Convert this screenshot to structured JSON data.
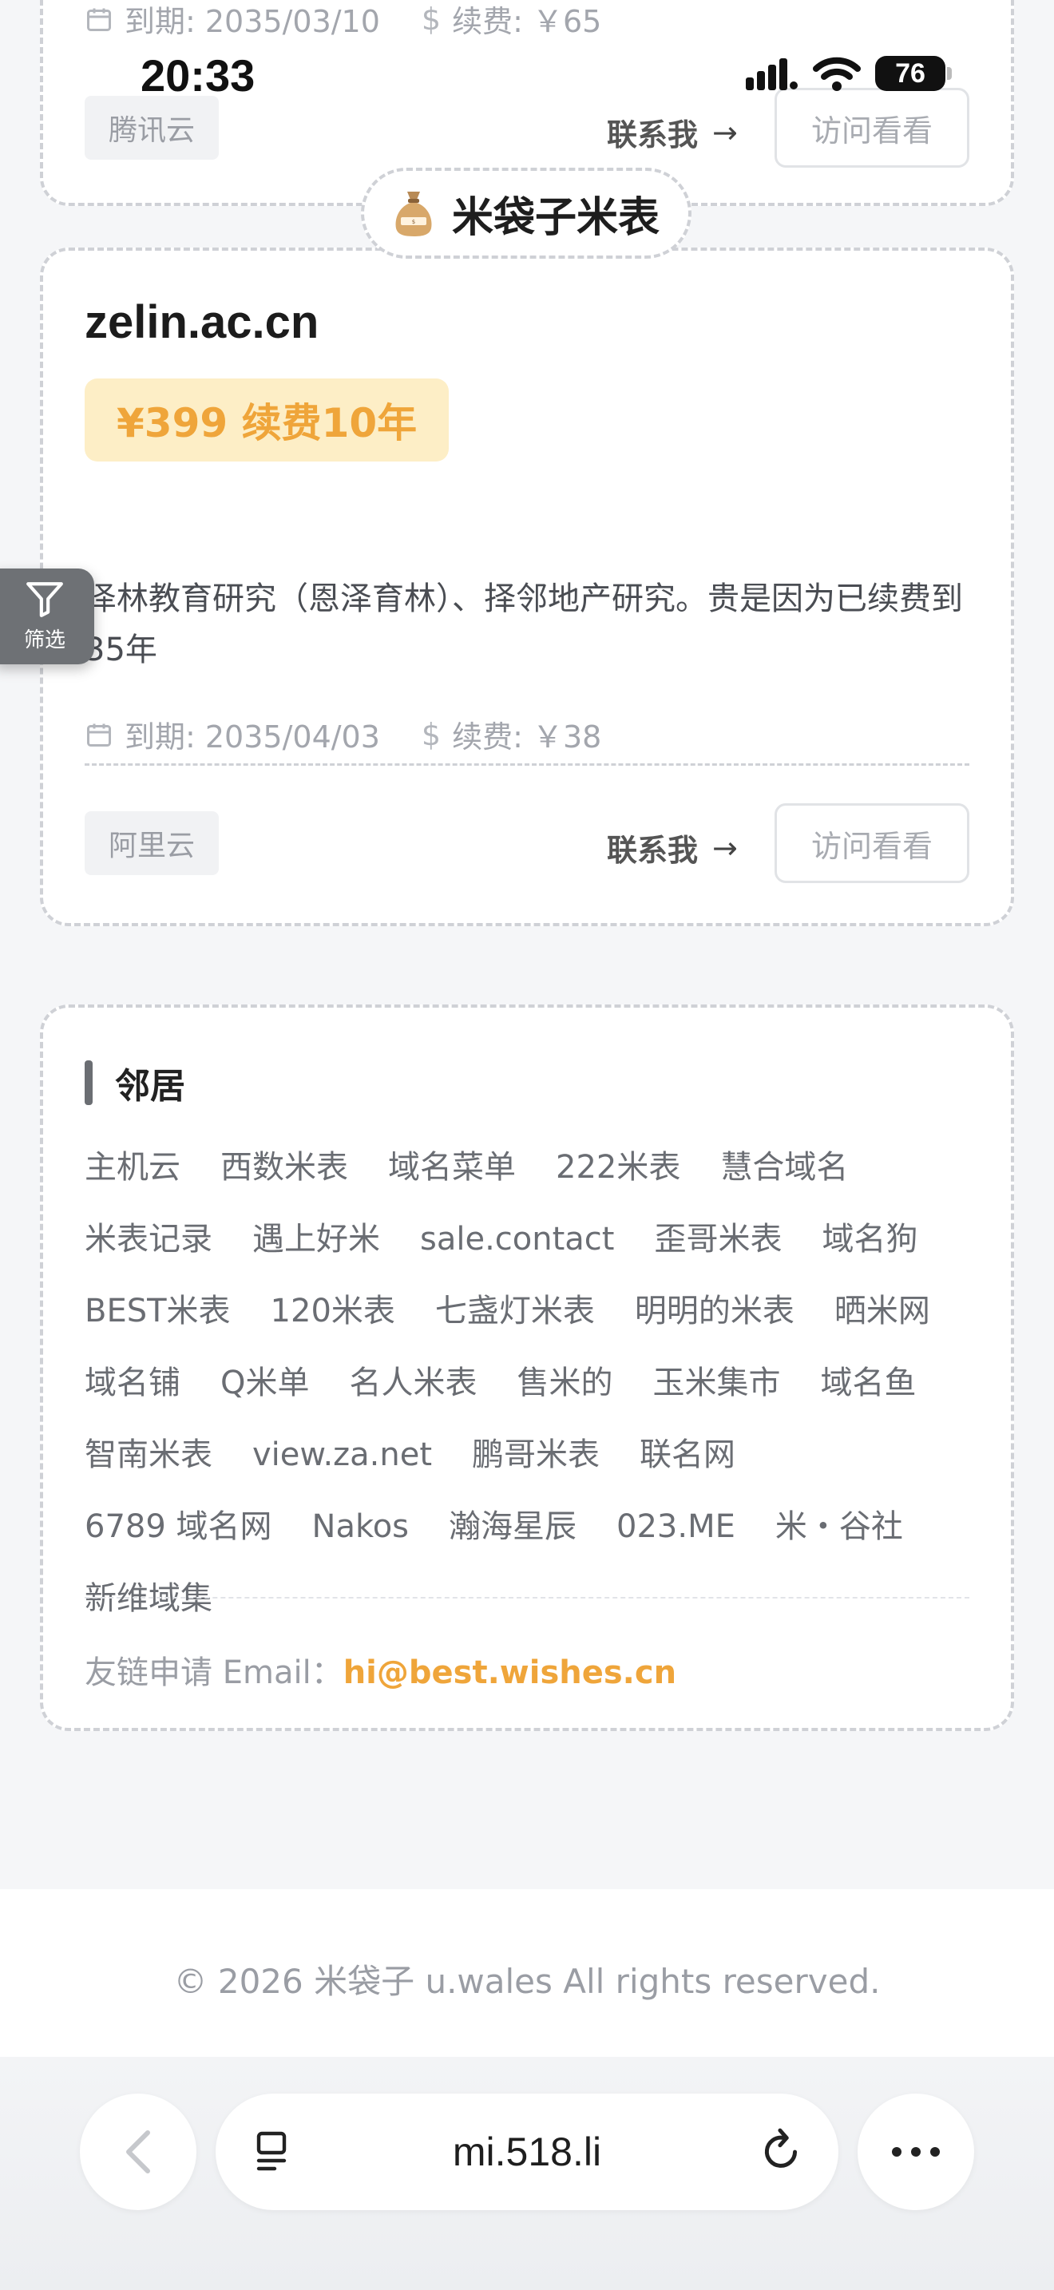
{
  "status_bar": {
    "time": "20:33",
    "battery": "76",
    "icons": [
      "signal-icon",
      "wifi-icon",
      "battery-icon"
    ]
  },
  "previous_card": {
    "expiry": "到期: 2035/03/10",
    "renewal": "续费: ￥65",
    "provider": "腾讯云",
    "contact_label": "联系我",
    "visit_label": "访问看看"
  },
  "section": {
    "title": "米袋子米表",
    "icon": "money-bag-icon"
  },
  "listing": {
    "domain": "zelin.ac.cn",
    "price": "¥399 续费10年",
    "description": "泽林教育研究（恩泽育林）、择邻地产研究。贵是因为已续费到35年",
    "expiry": "到期: 2035/04/03",
    "renewal": "续费: ￥38",
    "provider": "阿里云",
    "contact_label": "联系我",
    "visit_label": "访问看看"
  },
  "filter": {
    "label": "筛选",
    "icon": "filter-icon"
  },
  "neighbors": {
    "title": "邻居",
    "links": [
      "主机云",
      "西数米表",
      "域名菜单",
      "222米表",
      "慧合域名",
      "米表记录",
      "遇上好米",
      "sale.contact",
      "歪哥米表",
      "域名狗",
      "BEST米表",
      "120米表",
      "七盏灯米表",
      "明明的米表",
      "晒米网",
      "域名铺",
      "Q米单",
      "名人米表",
      "售米的",
      "玉米集市",
      "域名鱼",
      "智南米表",
      "view.za.net",
      "鹏哥米表",
      "联名网",
      "6789 域名网",
      "Nakos",
      "瀚海星辰",
      "023.ME",
      "米・谷社",
      "新维域集"
    ],
    "apply_label": "友链申请 Email：",
    "apply_email": "hi@best.wishes.cn"
  },
  "footer": {
    "copyright": "© 2026 米袋子 u.wales All rights reserved."
  },
  "browser": {
    "url": "mi.518.li"
  },
  "colors": {
    "accent": "#efa53a",
    "price_bg": "#fdeec6",
    "card_border": "#cfd1d6",
    "page_bg": "#f5f6f8"
  }
}
